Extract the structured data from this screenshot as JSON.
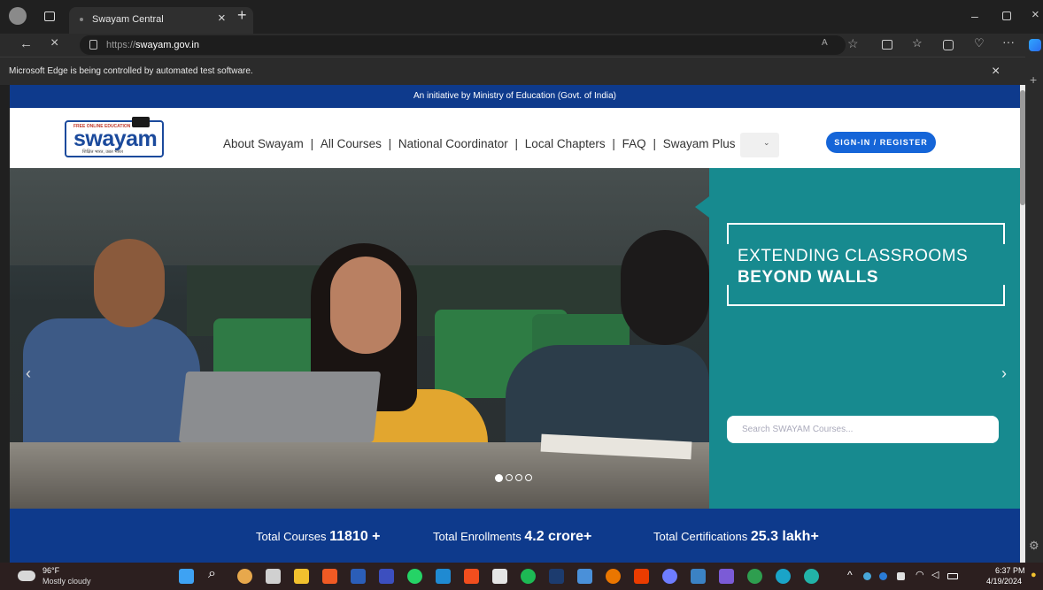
{
  "browser": {
    "tab_title": "Swayam Central",
    "url_prefix": "https://",
    "url_domain": "swayam.gov.in",
    "automation_notice": "Microsoft Edge is being controlled by automated test software."
  },
  "site": {
    "initiative": "An initiative by Ministry of Education (Govt. of India)",
    "logo": {
      "top_text": "FREE ONLINE EDUCATION",
      "name": "swayam",
      "sub_text": "शिक्षित भारत, उन्नत भारत"
    },
    "nav": [
      "About Swayam",
      "All Courses",
      "National Coordinator",
      "Local Chapters",
      "FAQ",
      "Swayam Plus"
    ],
    "nav_separator": "|",
    "signin_label": "SIGN-IN / REGISTER",
    "hero": {
      "tagline_line1": "EXTENDING CLASSROOMS",
      "tagline_line2": "BEYOND WALLS",
      "search_placeholder": "Search SWAYAM Courses...",
      "carousel_slides": 4,
      "active_slide": 1
    },
    "stats": [
      {
        "label": "Total Courses",
        "value": "11810 +"
      },
      {
        "label": "Total Enrollments",
        "value": "4.2 crore+"
      },
      {
        "label": "Total Certifications",
        "value": "25.3 lakh+"
      }
    ]
  },
  "taskbar": {
    "weather_temp": "96°F",
    "weather_desc": "Mostly cloudy",
    "time": "6:37 PM",
    "date": "4/19/2024"
  },
  "colors": {
    "brand_blue": "#0e3a8c",
    "teal_panel": "#178a8f",
    "signin_blue": "#1565d8"
  }
}
